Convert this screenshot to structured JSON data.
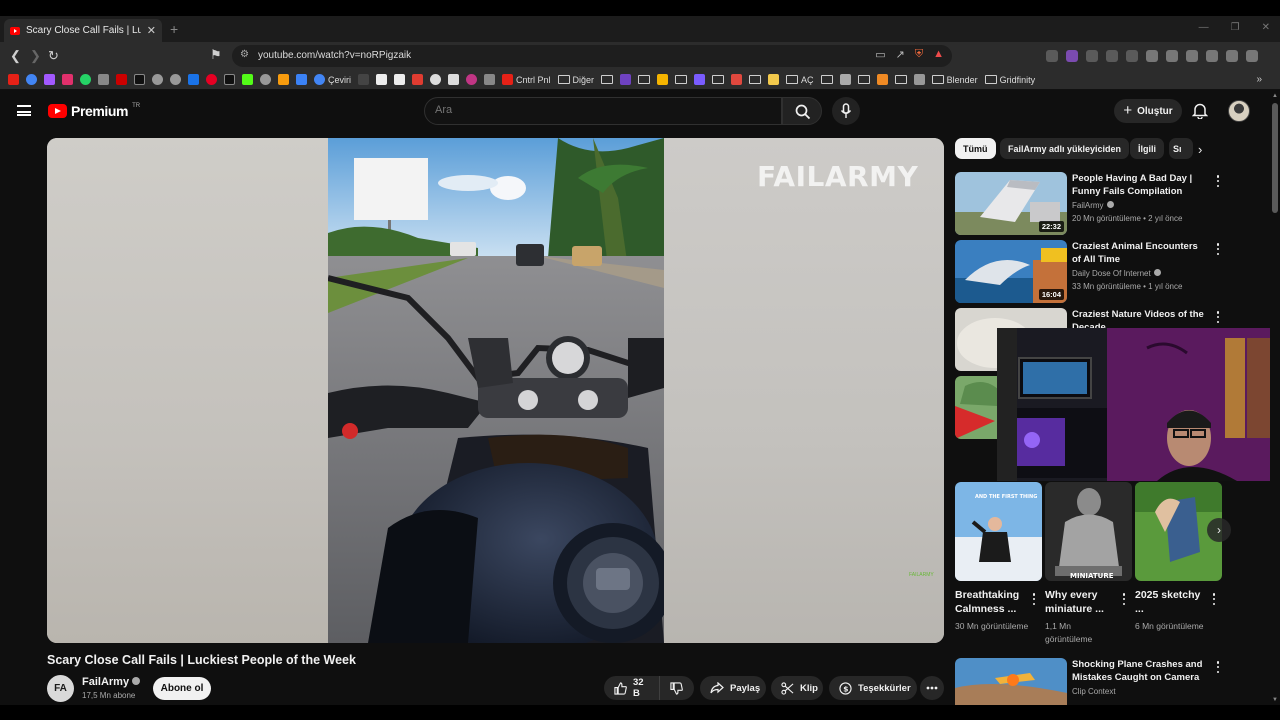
{
  "browser": {
    "tab_title": "Scary Close Call Fails | Luckiest P",
    "url": "youtube.com/watch?v=noRPigzaik",
    "bookmarks": [
      "Çeviri",
      "Cntrl Pnl",
      "Diğer",
      "AÇ",
      "Blender",
      "Gridfinity"
    ]
  },
  "header": {
    "logo_text": "Premium",
    "logo_country": "TR",
    "search_placeholder": "Ara",
    "create_label": "Oluştur"
  },
  "player": {
    "watermark": "FAILARMY",
    "corner_mark": "FAILARMY"
  },
  "video": {
    "title": "Scary Close Call Fails | Luckiest People of the Week",
    "channel": "FailArmy",
    "channel_initials": "FA",
    "subscribers": "17,5 Mn abone",
    "subscribe_label": "Abone ol",
    "like_count": "32 B",
    "share_label": "Paylaş",
    "clip_label": "Klip",
    "thanks_label": "Teşekkürler"
  },
  "chips": [
    "Tümü",
    "FailArmy adlı yükleyiciden",
    "İlgili",
    "Sı"
  ],
  "recommendations": [
    {
      "title": "People Having A Bad Day | Funny Fails Compilation",
      "channel": "FailArmy",
      "meta": "20 Mn görüntüleme • 2 yıl önce",
      "duration": "22:32"
    },
    {
      "title": "Craziest Animal Encounters of All Time",
      "channel": "Daily Dose Of Internet",
      "meta": "33 Mn görüntüleme • 1 yıl önce",
      "duration": "16:04"
    },
    {
      "title": "Craziest Nature Videos of the Decade",
      "channel": "",
      "meta": "",
      "duration": ""
    },
    {
      "title": "Shocking Plane Crashes and Mistakes Caught on Camera",
      "channel": "Clip Context",
      "meta": "",
      "duration": ""
    }
  ],
  "shorts": [
    {
      "title": "Breathtaking Calmness ...",
      "views": "30 Mn görüntüleme"
    },
    {
      "title": "Why every miniature ...",
      "views": "1,1 Mn görüntüleme"
    },
    {
      "title": "2025 sketchy ...",
      "views": "6 Mn görüntüleme"
    }
  ],
  "shorts_thumb_text": {
    "0": "AND THE FIRST THING",
    "1": "MINIATURE"
  }
}
